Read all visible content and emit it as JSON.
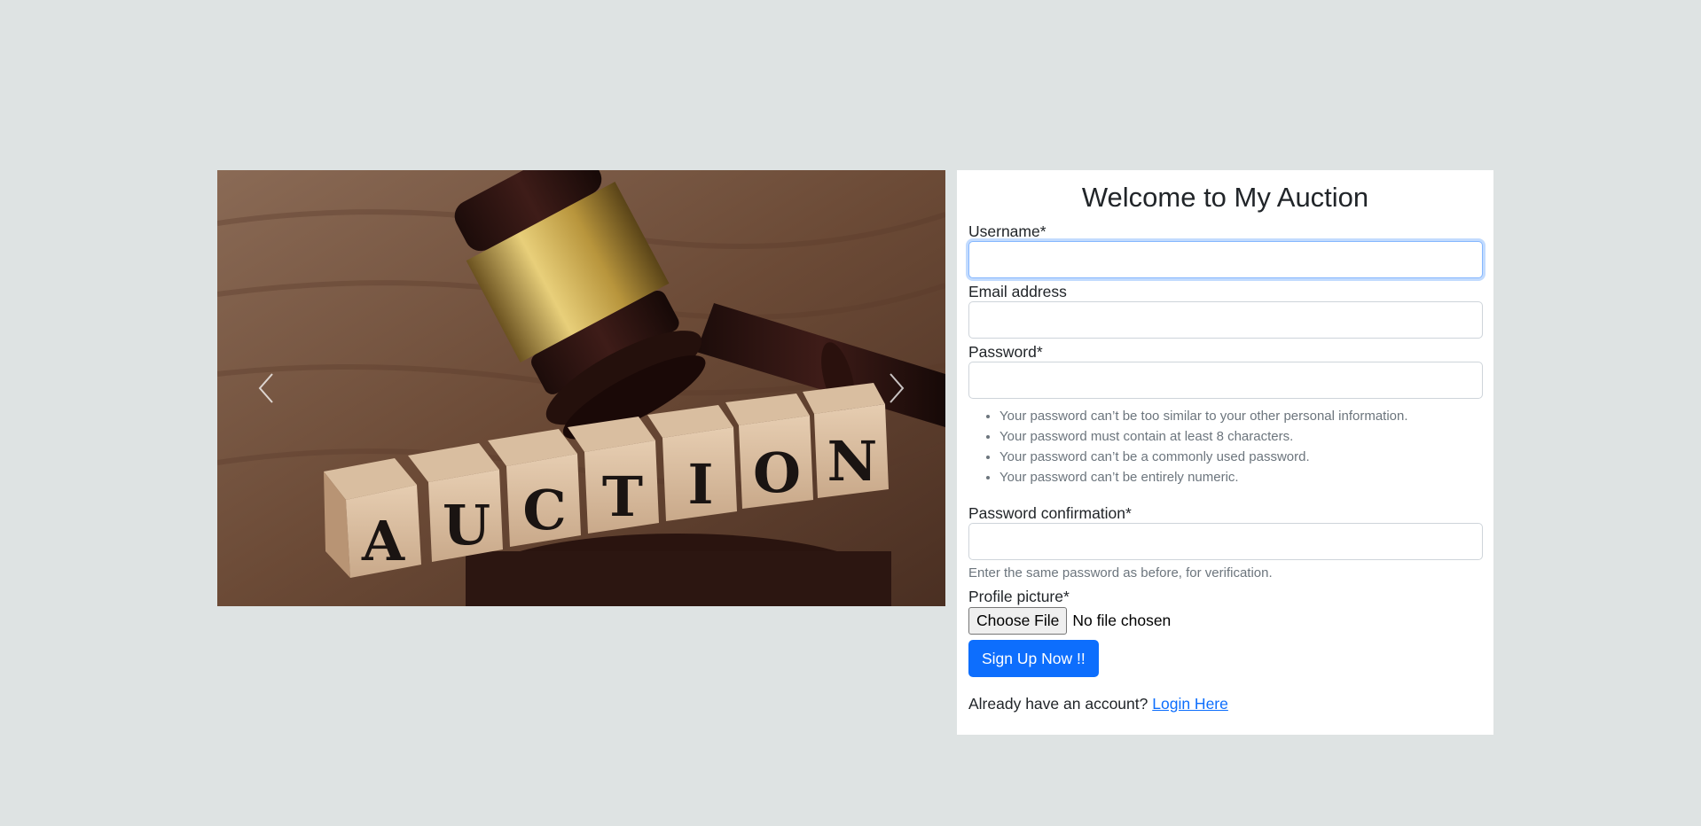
{
  "carousel": {
    "image_alt": "AUCTION",
    "blocks": [
      "A",
      "U",
      "C",
      "T",
      "I",
      "O",
      "N"
    ],
    "prev_icon": "chevron-left-icon",
    "next_icon": "chevron-right-icon"
  },
  "form": {
    "title": "Welcome to My Auction",
    "username_label": "Username*",
    "username_value": "",
    "email_label": "Email address",
    "email_value": "",
    "password_label": "Password*",
    "password_value": "",
    "password_hints": [
      "Your password can’t be too similar to your other personal information.",
      "Your password must contain at least 8 characters.",
      "Your password can’t be a commonly used password.",
      "Your password can’t be entirely numeric."
    ],
    "password2_label": "Password confirmation*",
    "password2_value": "",
    "password2_help": "Enter the same password as before, for verification.",
    "picture_label": "Profile picture*",
    "file_button": "Choose File",
    "file_status": "No file chosen",
    "submit_label": "Sign Up Now !!",
    "login_prompt": "Already have an account?",
    "login_link": "Login Here"
  },
  "colors": {
    "page_bg": "#dee3e3",
    "primary": "#0d6efd",
    "muted": "#6c757d"
  }
}
